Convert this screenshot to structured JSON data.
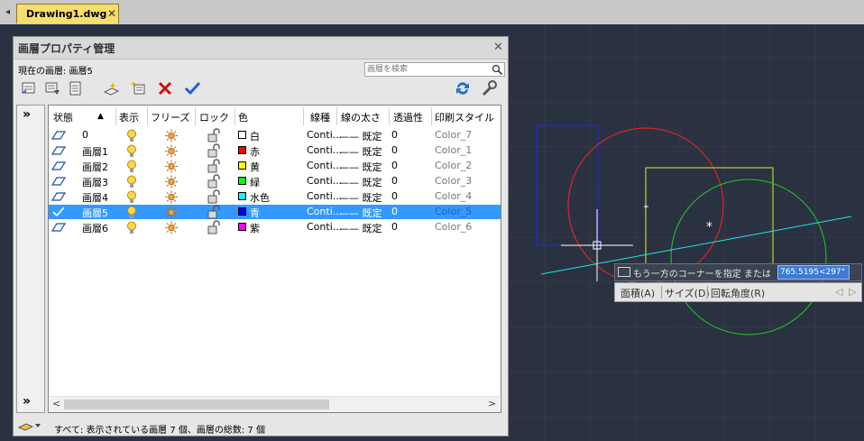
{
  "tab": {
    "back": "◂",
    "title": "Drawing1.dwg",
    "close": "✕"
  },
  "palette": {
    "title": "画層プロパティ管理",
    "close": "✕",
    "current_layer": "現在の画層: 画層5",
    "search_placeholder": "画層を検索",
    "expand_top": "»",
    "expand_bottom": "»",
    "status_text": "すべて: 表示されている画層 7 個、画層の総数: 7 個",
    "toolbar_icons": [
      "new-property-filter-icon",
      "new-group-filter-icon",
      "layer-states-manager-icon",
      "new-layer-icon",
      "new-layer-vp-frozen-icon",
      "delete-layer-icon",
      "set-current-icon",
      "refresh-icon",
      "settings-icon"
    ],
    "columns": [
      "状態",
      "▲",
      "表示",
      "フリーズ",
      "ロック",
      "色",
      "線種",
      "線の太さ",
      "透過性",
      "印刷スタイル"
    ],
    "layers": [
      {
        "name": "0",
        "color_name": "白",
        "color": "#ffffff",
        "linetype": "Conti...",
        "lineweight": "—— 既定",
        "transparency": "0",
        "plotstyle": "Color_7",
        "current": false
      },
      {
        "name": "画層1",
        "color_name": "赤",
        "color": "#ff0000",
        "linetype": "Conti...",
        "lineweight": "—— 既定",
        "transparency": "0",
        "plotstyle": "Color_1",
        "current": false
      },
      {
        "name": "画層2",
        "color_name": "黄",
        "color": "#ffff00",
        "linetype": "Conti...",
        "lineweight": "—— 既定",
        "transparency": "0",
        "plotstyle": "Color_2",
        "current": false
      },
      {
        "name": "画層3",
        "color_name": "緑",
        "color": "#00ff00",
        "linetype": "Conti...",
        "lineweight": "—— 既定",
        "transparency": "0",
        "plotstyle": "Color_3",
        "current": false
      },
      {
        "name": "画層4",
        "color_name": "水色",
        "color": "#00ffff",
        "linetype": "Conti...",
        "lineweight": "—— 既定",
        "transparency": "0",
        "plotstyle": "Color_4",
        "current": false
      },
      {
        "name": "画層5",
        "color_name": "青",
        "color": "#0000ff",
        "linetype": "Conti...",
        "lineweight": "—— 既定",
        "transparency": "0",
        "plotstyle": "Color_5",
        "current": true
      },
      {
        "name": "画層6",
        "color_name": "紫",
        "color": "#ff00ff",
        "linetype": "Conti...",
        "lineweight": "—— 既定",
        "transparency": "0",
        "plotstyle": "Color_6",
        "current": false
      }
    ]
  },
  "prompt": {
    "text": "もう一方のコーナーを指定 または",
    "value": "765.5195<297°",
    "options": [
      "面積(A)",
      "サイズ(D)",
      "回転角度(R)"
    ],
    "nav_prev": "◁",
    "nav_next": "▷"
  }
}
